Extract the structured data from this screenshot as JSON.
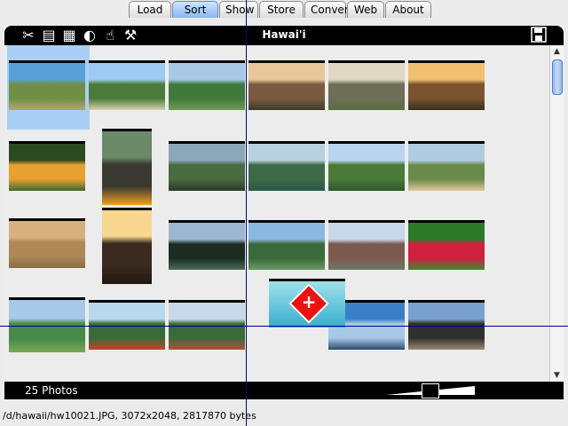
{
  "tabs": [
    {
      "label": "Load",
      "active": false
    },
    {
      "label": "Sort",
      "active": true
    },
    {
      "label": "Show",
      "active": false
    },
    {
      "label": "Store",
      "active": false
    },
    {
      "label": "Convert",
      "active": false
    },
    {
      "label": "Web",
      "active": false
    },
    {
      "label": "About",
      "active": false
    }
  ],
  "panel": {
    "title": "Hawai'i",
    "tools": [
      {
        "name": "scissors-icon",
        "glyph": "✂"
      },
      {
        "name": "copy-icon",
        "glyph": "▤"
      },
      {
        "name": "paste-icon",
        "glyph": "▦"
      },
      {
        "name": "rotate-icon",
        "glyph": "◐"
      },
      {
        "name": "pointer-hand-icon",
        "glyph": "☝"
      },
      {
        "name": "broom-icon",
        "glyph": "⚒"
      }
    ],
    "save_icon": "floppy-disk-icon",
    "photo_count": "25 Photos"
  },
  "thumbnails": [
    {
      "colors": [
        "#5aa0d8",
        "#6e8f45",
        "#b2a57a"
      ]
    },
    {
      "colors": [
        "#9ccaf0",
        "#4c7a3a",
        "#d8cfb0"
      ]
    },
    {
      "colors": [
        "#a8c8e6",
        "#3f7a3c",
        "#6f9a58"
      ]
    },
    {
      "colors": [
        "#e8c89a",
        "#7a5a40",
        "#3d3a2c"
      ]
    },
    {
      "colors": [
        "#e0d8c4",
        "#6e6e58",
        "#5b6e3c"
      ]
    },
    {
      "colors": [
        "#f0c070",
        "#7a5430",
        "#3a2e20"
      ]
    },
    {
      "colors": [
        "#2c4a20",
        "#e8a030",
        "#3c6a30"
      ]
    },
    {
      "colors": [
        "#6a8a68",
        "#3a3a30",
        "#f0a020"
      ]
    },
    {
      "colors": [
        "#8aa8b8",
        "#4a6a40",
        "#2a3a28"
      ]
    },
    {
      "colors": [
        "#b8d0e0",
        "#3c6a48",
        "#2a5848"
      ]
    },
    {
      "colors": [
        "#b8d4ee",
        "#4a7a38",
        "#2e5a2a"
      ]
    },
    {
      "colors": [
        "#b0cce0",
        "#6a8a4a",
        "#e0c8a0"
      ]
    },
    {
      "colors": [
        "#d8b080",
        "#b08858",
        "#8a6a48"
      ]
    },
    {
      "colors": [
        "#f8d890",
        "#3a2a20",
        "#20180e"
      ]
    },
    {
      "colors": [
        "#9cb8d0",
        "#1c2c20",
        "#4a6a58"
      ]
    },
    {
      "colors": [
        "#8ab8e0",
        "#3a6a3a",
        "#6a9a68"
      ]
    },
    {
      "colors": [
        "#c8d8e8",
        "#7a5a50",
        "#6a7a60"
      ]
    },
    {
      "colors": [
        "#2a7a2a",
        "#d02040",
        "#3a8a30"
      ]
    },
    {
      "colors": [
        "#a8c8e8",
        "#4a8a48",
        "#7aa858"
      ]
    },
    {
      "colors": [
        "#b8d8ee",
        "#3a6a38",
        "#c84030"
      ]
    },
    {
      "colors": [
        "#c8d8e8",
        "#3a6a38",
        "#b05040"
      ]
    },
    {
      "colors": [
        "#3a80c8",
        "#a8c8e8",
        "#2a4a70"
      ]
    },
    {
      "colors": [
        "#7aa0d0",
        "#303030",
        "#9a8a70"
      ]
    }
  ],
  "status_text": "/d/hawaii/hw10021.JPG, 3072x2048, 2817870 bytes"
}
